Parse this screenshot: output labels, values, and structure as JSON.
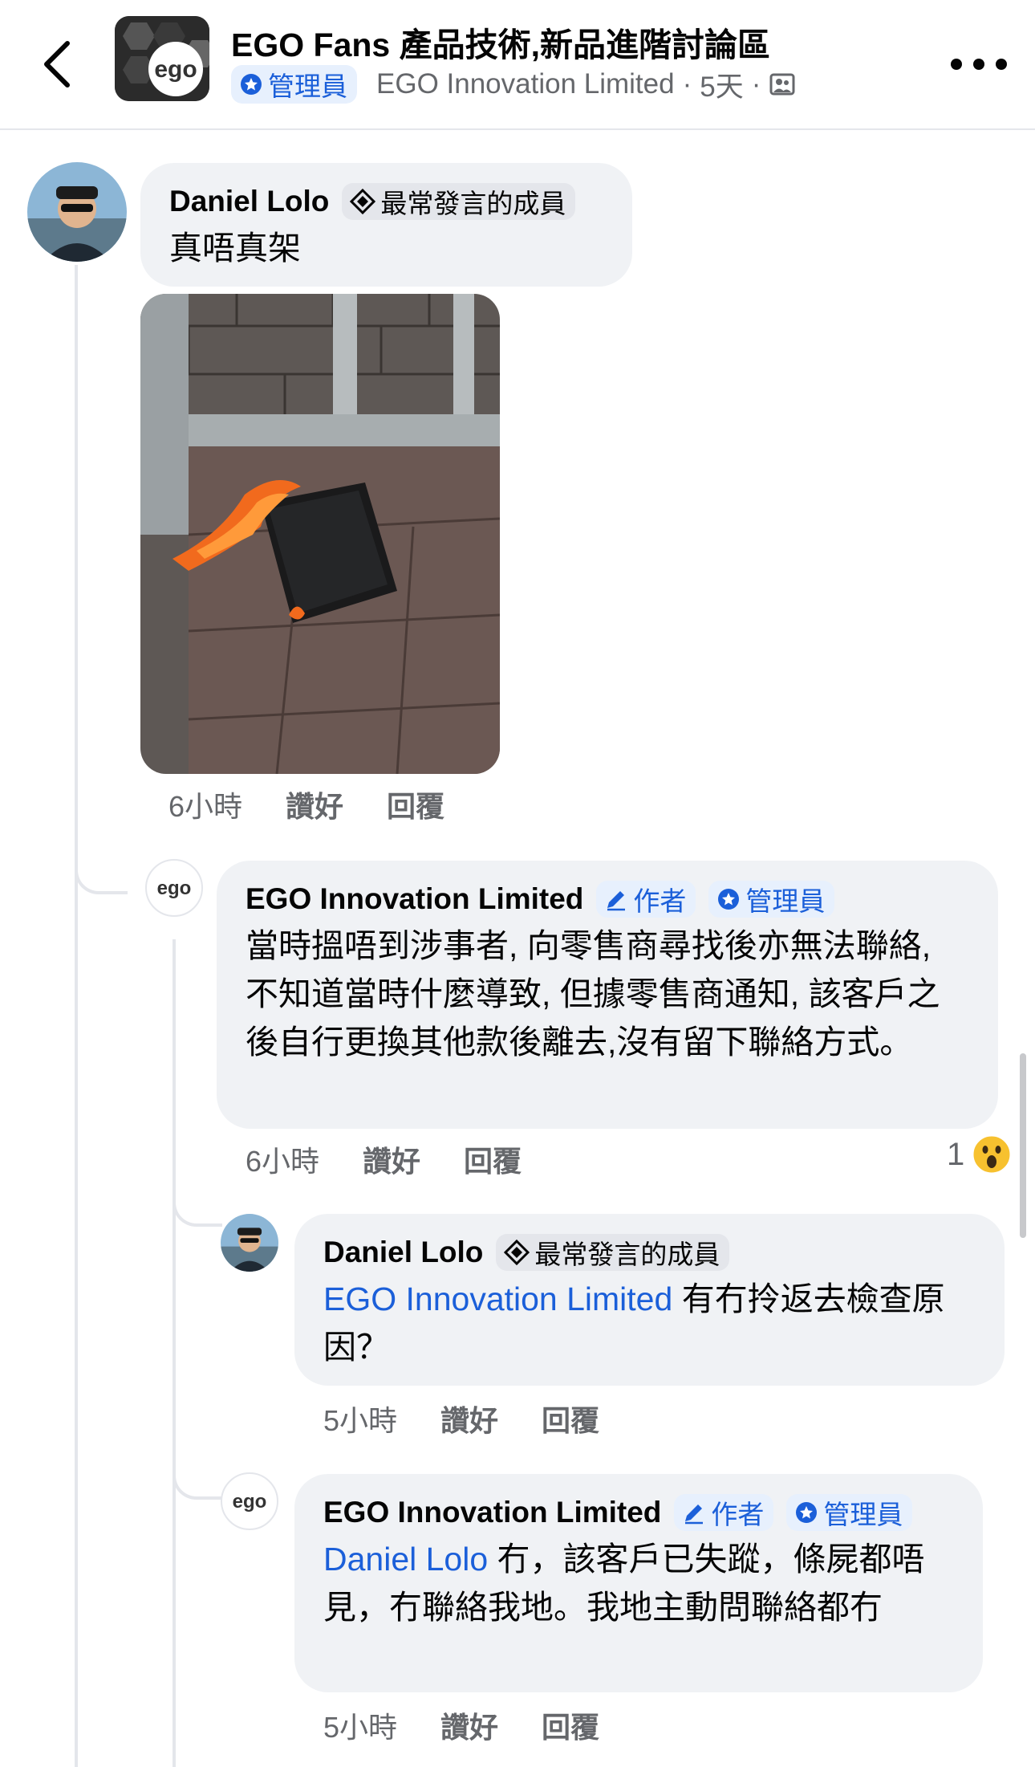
{
  "header": {
    "group_name": "EGO Fans 產品技術,新品進階討論區",
    "role_badge": "管理員",
    "poster": "EGO Innovation Limited",
    "separator": "·",
    "age": "5天",
    "separator2": "·"
  },
  "comments": [
    {
      "author": "Daniel Lolo",
      "badge": "最常發言的成員",
      "text": "真唔真架",
      "time": "6小時",
      "like_label": "讚好",
      "reply_label": "回覆",
      "has_photo": true
    },
    {
      "author": "EGO Innovation Limited",
      "badge_author": "作者",
      "badge_admin": "管理員",
      "text": "當時搵唔到涉事者, 向零售商尋找後亦無法聯絡, 不知道當時什麼導致, 但據零售商通知, 該客戶之後自行更換其他款後離去,沒有留下聯絡方式。",
      "time": "6小時",
      "like_label": "讚好",
      "reply_label": "回覆",
      "reaction_count": "1",
      "reaction_type": "wow"
    },
    {
      "author": "Daniel Lolo",
      "badge": "最常發言的成員",
      "mention": "EGO Innovation Limited",
      "text": " 有冇拎返去檢查原因？",
      "time": "5小時",
      "like_label": "讚好",
      "reply_label": "回覆"
    },
    {
      "author": "EGO Innovation Limited",
      "badge_author": "作者",
      "badge_admin": "管理員",
      "mention": "Daniel Lolo",
      "text": " 冇，該客戶已失蹤，條屍都唔見，冇聯絡我地。我地主動問聯絡都冇",
      "time": "5小時",
      "like_label": "讚好",
      "reply_label": "回覆"
    }
  ],
  "colors": {
    "accent": "#1b5fd9",
    "bubble": "#f0f2f5",
    "secondary_text": "#65676b"
  }
}
